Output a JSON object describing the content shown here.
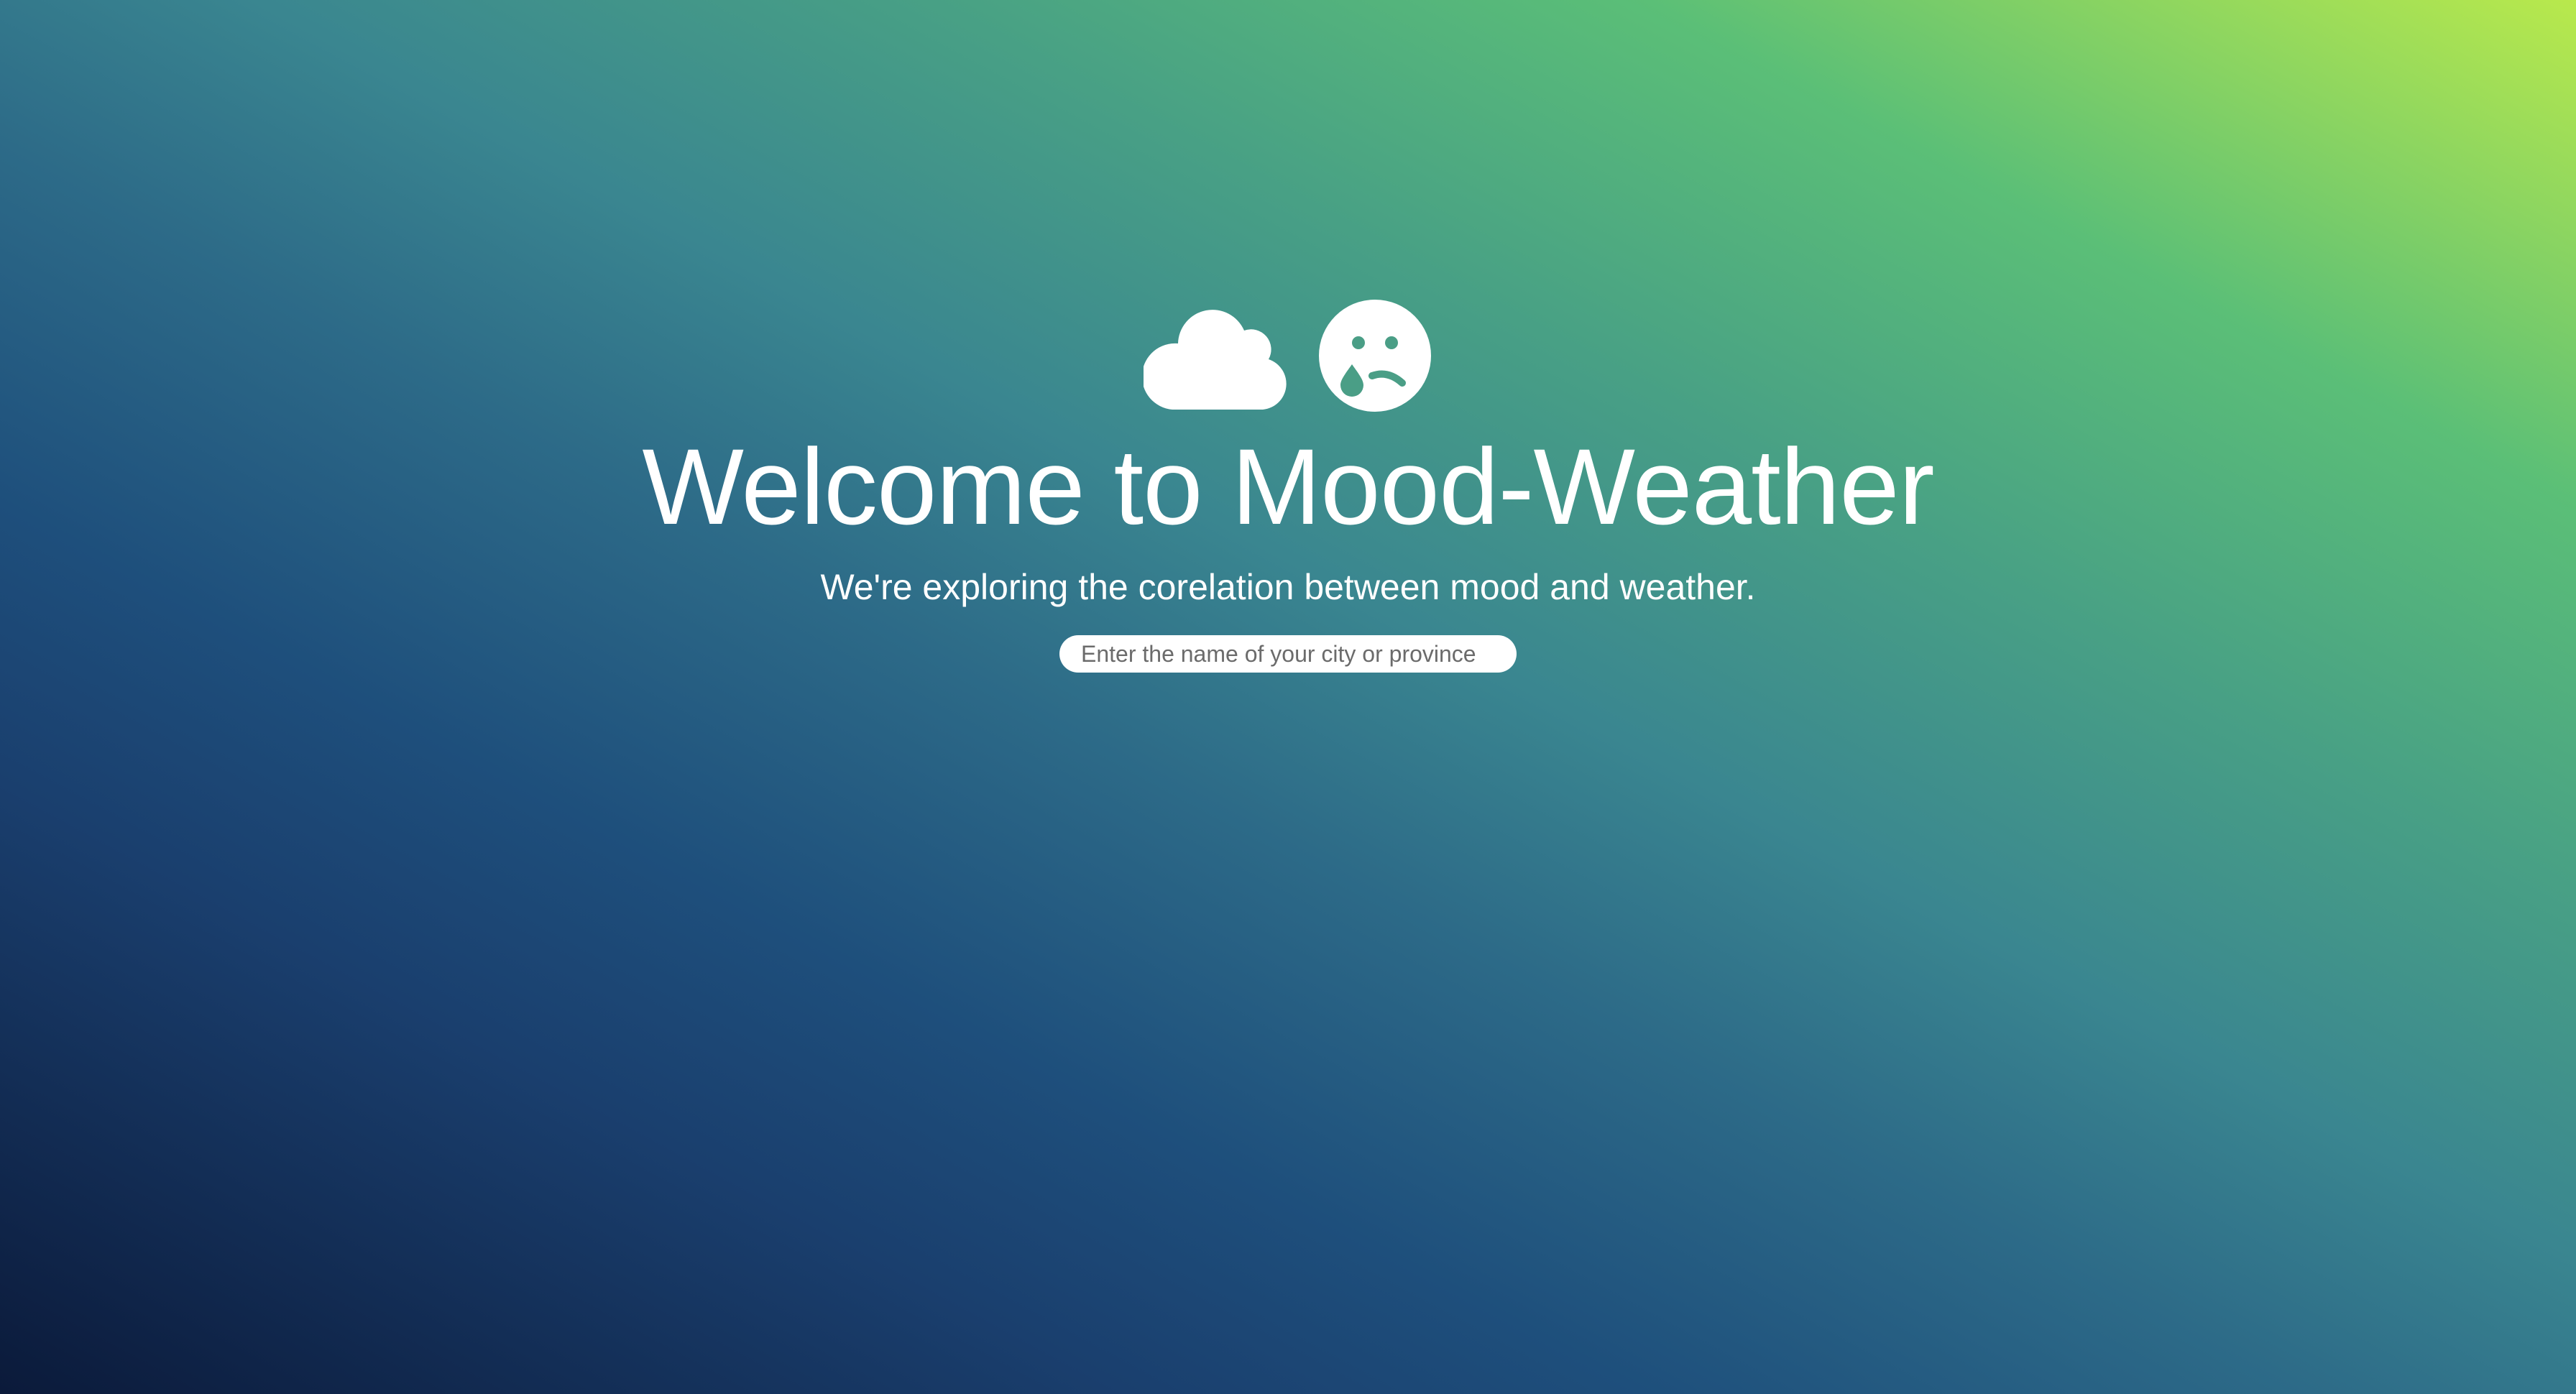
{
  "hero": {
    "icons": [
      "cloud-icon",
      "crying-face-icon"
    ],
    "title": "Welcome to Mood-Weather",
    "subtitle": "We're exploring the corelation between mood and weather.",
    "search": {
      "placeholder": "Enter the name of your city or province",
      "value": ""
    }
  },
  "colors": {
    "text": "#ffffff",
    "input_bg": "#ffffff",
    "icon_accent": "#4a9e86",
    "gradient_dark": "#0b1a3a",
    "gradient_mid": "#3a8690",
    "gradient_light": "#b9e94c"
  }
}
